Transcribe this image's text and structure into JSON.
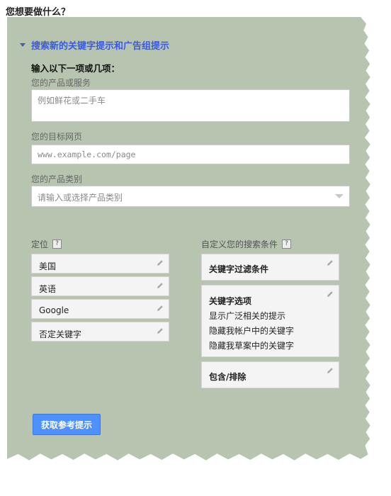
{
  "page": {
    "title": "您想要做什么？"
  },
  "section": {
    "toggle_label": "搜索新的关键字提示和广告组提示"
  },
  "form": {
    "heading": "输入以下一项或几项：",
    "product_label": "您的产品或服务",
    "product_placeholder": "例如鲜花或二手车",
    "landing_label": "您的目标网页",
    "landing_placeholder": "www.example.com/page",
    "category_label": "您的产品类别",
    "category_placeholder": "请输入或选择产品类别"
  },
  "targeting": {
    "header": "定位",
    "help": "?",
    "items": [
      {
        "label": "美国"
      },
      {
        "label": "英语"
      },
      {
        "label": "Google"
      },
      {
        "label": "否定关键字"
      }
    ]
  },
  "custom": {
    "header": "自定义您的搜索条件",
    "help": "?",
    "filter_card": {
      "label": "关键字过滤条件"
    },
    "options_card": {
      "title": "关键字选项",
      "lines": [
        "显示广泛相关的提示",
        "隐藏我帐户中的关键字",
        "隐藏我草案中的关键字"
      ]
    },
    "include_card": {
      "label": "包含/排除"
    }
  },
  "actions": {
    "submit_label": "获取参考提示"
  },
  "colors": {
    "panel_bg": "#b6c4b0",
    "link": "#3b5bdb",
    "button": "#4d90fe"
  }
}
